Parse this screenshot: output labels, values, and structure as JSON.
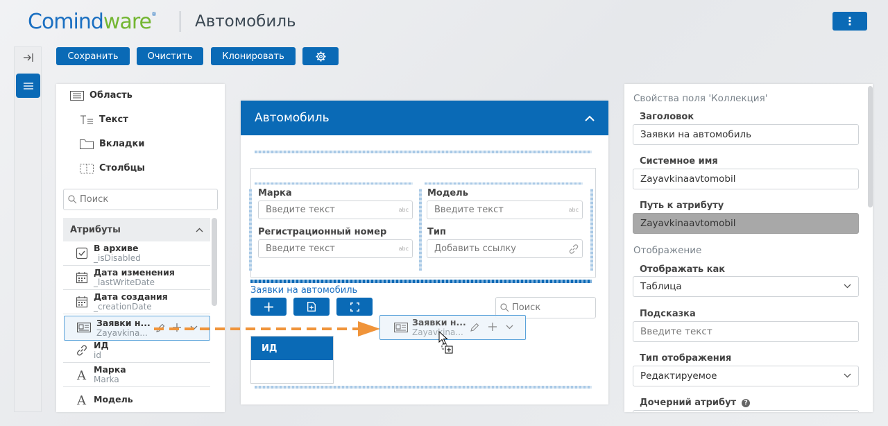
{
  "header": {
    "logo_prefix": "Comind",
    "logo_suffix": "ware",
    "logo_reg": "®",
    "page_title": "Автомобиль",
    "kebab_label": "⋮"
  },
  "toolbar": {
    "save_label": "Сохранить",
    "clear_label": "Очистить",
    "clone_label": "Клонировать"
  },
  "palette": {
    "items": [
      {
        "label": "Область",
        "icon": "area-icon"
      },
      {
        "label": "Текст",
        "icon": "text-icon"
      },
      {
        "label": "Вкладки",
        "icon": "tabs-icon"
      },
      {
        "label": "Столбцы",
        "icon": "columns-icon"
      }
    ],
    "search_placeholder": "Поиск",
    "attributes_header": "Атрибуты",
    "attributes": [
      {
        "title": "В архиве",
        "sub": "_isDisabled",
        "icon": "checkbox-icon"
      },
      {
        "title": "Дата изменения",
        "sub": "_lastWriteDate",
        "icon": "calendar-icon"
      },
      {
        "title": "Дата создания",
        "sub": "_creationDate",
        "icon": "calendar-icon"
      },
      {
        "title": "Заявки н...",
        "sub": "Zayavkina...",
        "icon": "collection-icon"
      },
      {
        "title": "ИД",
        "sub": "id",
        "icon": "link-icon"
      },
      {
        "title": "Марка",
        "sub": "Marka",
        "icon": "text-a-icon"
      },
      {
        "title": "Модель",
        "sub": "",
        "icon": "text-a-icon"
      }
    ]
  },
  "canvas": {
    "title": "Автомобиль",
    "fields": {
      "marka_label": "Марка",
      "marka_placeholder": "Введите текст",
      "model_label": "Модель",
      "model_placeholder": "Введите текст",
      "reg_label": "Регистрационный номер",
      "reg_placeholder": "Введите текст",
      "type_label": "Тип",
      "type_placeholder": "Добавить ссылку",
      "abc": "abc"
    },
    "collection_label": "Заявки на автомобиль",
    "search_placeholder": "Поиск",
    "table_header": "ИД",
    "ghost_title": "Заявки н...",
    "ghost_sub": "Zayavkina..."
  },
  "properties": {
    "section_title": "Свойства поля 'Коллекция'",
    "title_label": "Заголовок",
    "title_value": "Заявки на автомобиль",
    "sysname_label": "Системное имя",
    "sysname_value": "Zayavkinaavtomobil",
    "path_label": "Путь к атрибуту",
    "path_value": "Zayavkinaavtomobil",
    "display_section": "Отображение",
    "display_as_label": "Отображать как",
    "display_as_value": "Таблица",
    "hint_label": "Подсказка",
    "hint_placeholder": "Введите текст",
    "display_type_label": "Тип отображения",
    "display_type_value": "Редактируемое",
    "child_attr_label": "Дочерний атрибут",
    "help": "?"
  },
  "colors": {
    "primary": "#0a6ab6",
    "logo_blue": "#1a6fc1",
    "logo_green": "#73b632",
    "drag_arrow": "#f0943a"
  }
}
